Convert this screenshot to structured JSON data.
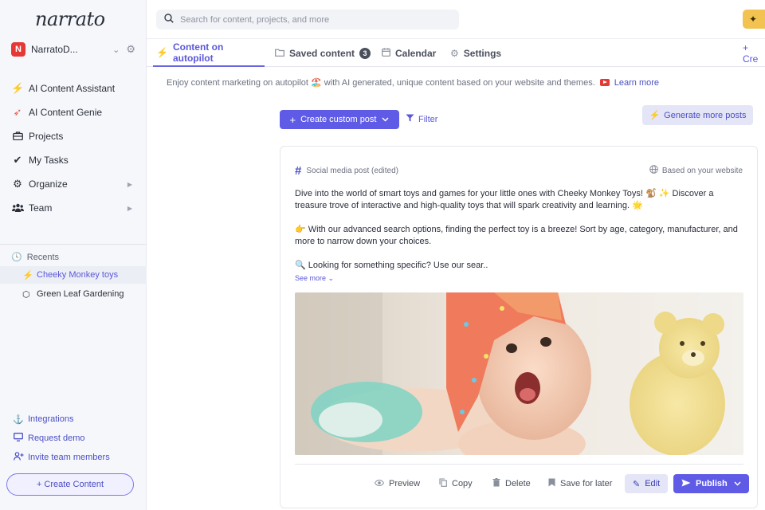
{
  "app": {
    "logo": "narrato"
  },
  "workspace": {
    "badge": "N",
    "name": "NarratoD..."
  },
  "nav": [
    {
      "icon": "lightning-icon",
      "label": "AI Content Assistant",
      "glyph": "⚡"
    },
    {
      "icon": "rocket-icon",
      "label": "AI Content Genie",
      "glyph": "🚀"
    },
    {
      "icon": "briefcase-icon",
      "label": "Projects",
      "glyph": "💼"
    },
    {
      "icon": "checkmark-icon",
      "label": "My Tasks",
      "glyph": "✔"
    },
    {
      "icon": "organize-icon",
      "label": "Organize",
      "glyph": "⚙"
    },
    {
      "icon": "team-icon",
      "label": "Team",
      "glyph": "👥"
    }
  ],
  "recents": {
    "title": "Recents",
    "items": [
      {
        "label": "Cheeky Monkey toys"
      },
      {
        "label": "Green Leaf Gardening"
      }
    ]
  },
  "bottom_links": [
    {
      "label": "Integrations",
      "icon": "anchor-icon"
    },
    {
      "label": "Request demo",
      "icon": "monitor-icon"
    },
    {
      "label": "Invite team members",
      "icon": "add-user-icon"
    }
  ],
  "create_content": "+ Create Content",
  "search": {
    "placeholder": "Search for content, projects, and more"
  },
  "tabs": [
    {
      "label": "Content on autopilot"
    },
    {
      "label": "Saved content",
      "count": "3"
    },
    {
      "label": "Calendar"
    },
    {
      "label": "Settings"
    }
  ],
  "create_link": "+ Cre",
  "banner": {
    "text": "Enjoy content marketing on autopilot 🏖️ with AI generated, unique content based on your website and themes.",
    "learn_more": "Learn more"
  },
  "toolbar": {
    "create_custom_post": "Create custom post",
    "filter": "Filter",
    "generate_more": "Generate more posts"
  },
  "post": {
    "type": "Social media post (edited)",
    "source": "Based on your website",
    "paragraphs": [
      "Dive into the world of smart toys and games for your little ones with Cheeky Monkey Toys! 🐒 ✨ Discover a treasure trove of interactive and high-quality toys that will spark creativity and learning. 🌟",
      "👉 With our advanced search options, finding the perfect toy is a breeze! Sort by age, category, manufacturer, and more to narrow down your choices.",
      "🔍 Looking for something specific? Use our sear.."
    ],
    "see_more": "See more"
  },
  "actions": {
    "preview": "Preview",
    "copy": "Copy",
    "delete": "Delete",
    "save_later": "Save for later",
    "edit": "Edit",
    "publish": "Publish"
  },
  "colors": {
    "accent": "#5f5be6",
    "brand_badge": "#e53935",
    "upgrade": "#f2c350"
  }
}
